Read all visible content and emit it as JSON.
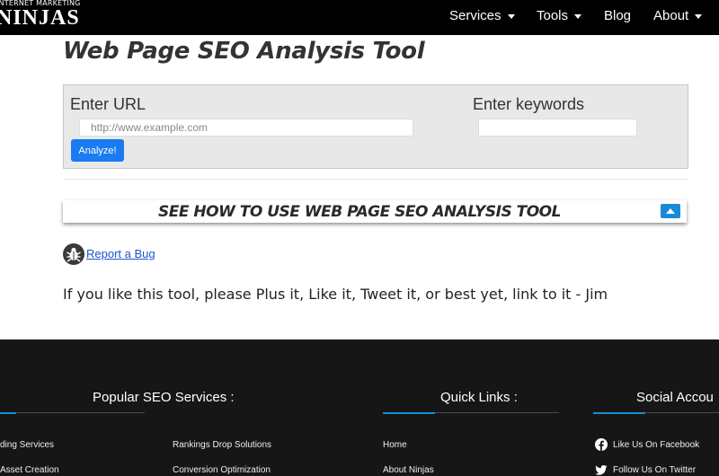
{
  "header": {
    "logo_small": "INTERNET MARKETING",
    "logo_big": "NINJAS",
    "nav": [
      "Services",
      "Tools",
      "Blog",
      "About"
    ]
  },
  "main": {
    "title": "Web Page SEO Analysis Tool",
    "url_label": "Enter URL",
    "url_placeholder": "http://www.example.com",
    "keywords_label": "Enter keywords",
    "keywords_value": "",
    "analyze_label": "Analyze!",
    "howto_label": "SEE HOW TO USE WEB PAGE SEO ANALYSIS TOOL",
    "bug_link": "Report a Bug",
    "plug_text": "If you like this tool, please Plus it, Like it, Tweet it, or best yet, link to it - Jim"
  },
  "footer": {
    "popular_title": "Popular SEO Services :",
    "quick_title": "Quick Links :",
    "social_title": "Social Accou",
    "col1": [
      "ding Services",
      "Asset Creation"
    ],
    "col2": [
      "Rankings Drop Solutions",
      "Conversion Optimization"
    ],
    "quick_links": [
      "Home",
      "About Ninjas"
    ],
    "social_links": [
      "Like Us On Facebook",
      "Follow Us On Twitter"
    ]
  },
  "colors": {
    "accent": "#1a7cf0",
    "footer_bg": "#161616",
    "panel_bg": "#e8e8e8"
  }
}
